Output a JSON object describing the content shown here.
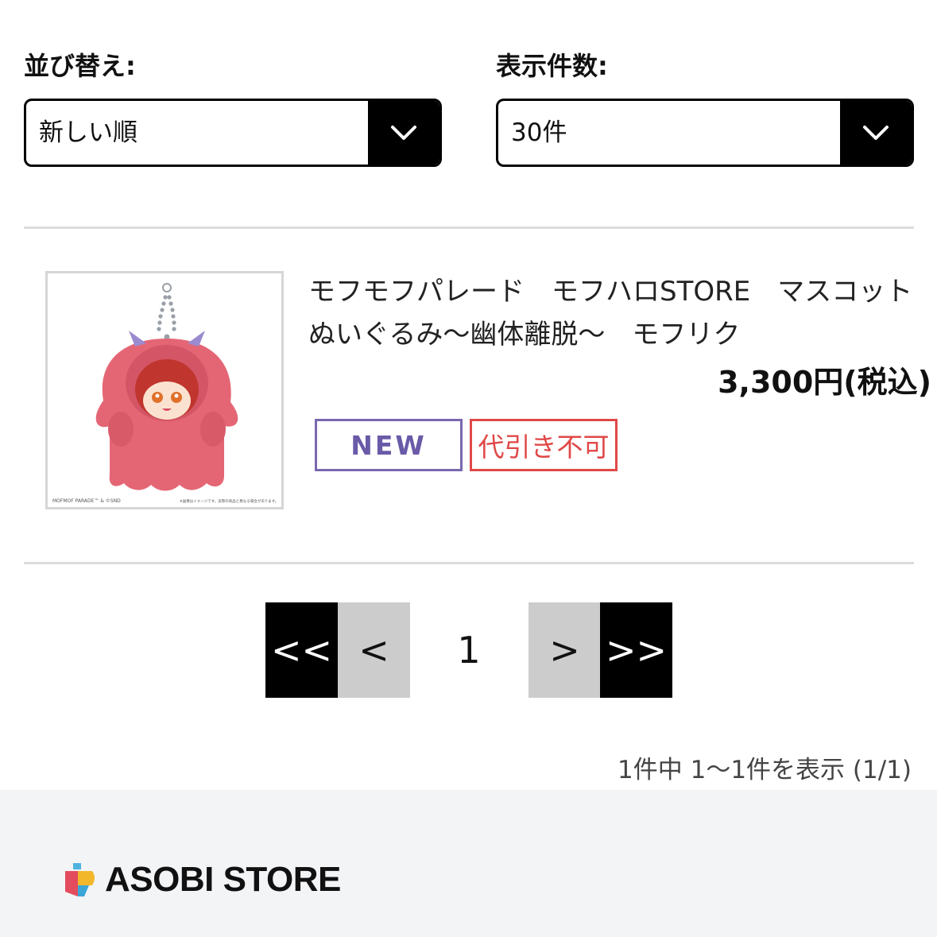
{
  "sort": {
    "label": "並び替え:",
    "selected": "新しい順"
  },
  "per_page": {
    "label": "表示件数:",
    "selected": "30件"
  },
  "product": {
    "title": "モフモフパレード　モフハロSTORE　マスコットぬいぐるみ〜幽体離脱〜　モフリク",
    "price": "3,300円(税込)",
    "badges": {
      "new": "NEW",
      "cod": "代引き不可"
    },
    "image_caption_left": "MOFMOF PARADE™ & ©SND",
    "image_caption_right": "※画像はイメージです。実際の商品と異なる場合があります。"
  },
  "pagination": {
    "first": "<<",
    "prev": "<",
    "current": "1",
    "next": ">",
    "last": ">>"
  },
  "result_count": "1件中 1〜1件を表示 (1/1)",
  "footer": {
    "brand": "ASOBI STORE"
  }
}
